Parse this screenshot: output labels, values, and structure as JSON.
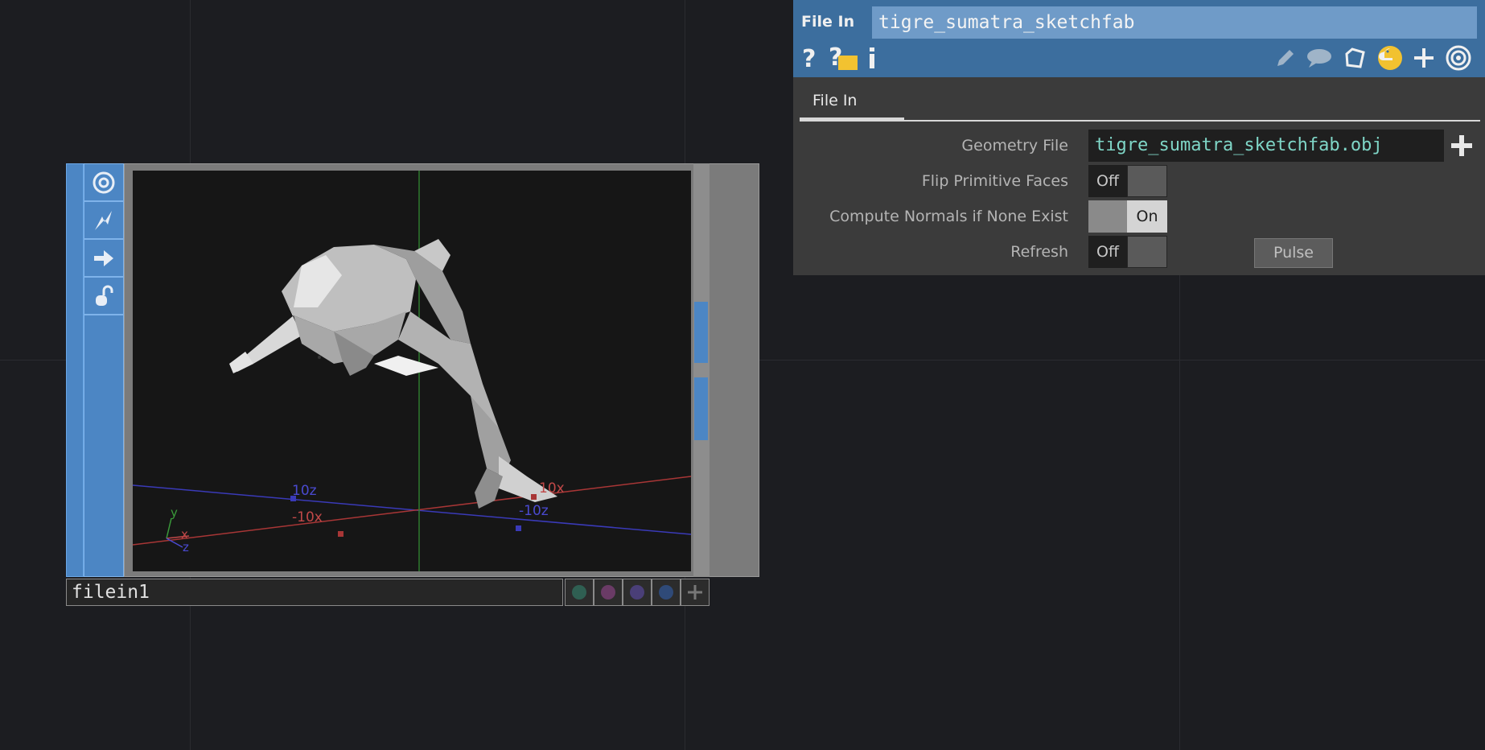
{
  "node": {
    "name": "filein1",
    "toolbar_icons": [
      "viewer-target-icon",
      "cook-lightning-icon",
      "arrow-right-icon",
      "lock-open-icon"
    ],
    "axis_labels": {
      "pos_z": "10z",
      "neg_x": "-10x",
      "pos_x": "10x",
      "neg_z": "-10z",
      "gizmo_y": "y",
      "gizmo_x": "x",
      "gizmo_z": "z"
    },
    "flag_colors": [
      "#2f5f52",
      "#6a3b66",
      "#4a3f78",
      "#2f4a78"
    ]
  },
  "panel": {
    "op_type": "File In",
    "op_name": "tigre_sumatra_sketchfab",
    "header_icons": [
      "help-icon",
      "help-python-icon",
      "info-icon",
      "pencil-icon",
      "comment-icon",
      "clone-icon",
      "python-icon",
      "add-icon",
      "viewer-icon"
    ],
    "tab": "File In",
    "params": {
      "geometry_file": {
        "label": "Geometry File",
        "value": "tigre_sumatra_sketchfab.obj"
      },
      "flip_faces": {
        "label": "Flip Primitive Faces",
        "value": "Off"
      },
      "compute_normals": {
        "label": "Compute Normals if None Exist",
        "value": "On"
      },
      "refresh": {
        "label": "Refresh",
        "value": "Off",
        "pulse_label": "Pulse"
      }
    }
  }
}
